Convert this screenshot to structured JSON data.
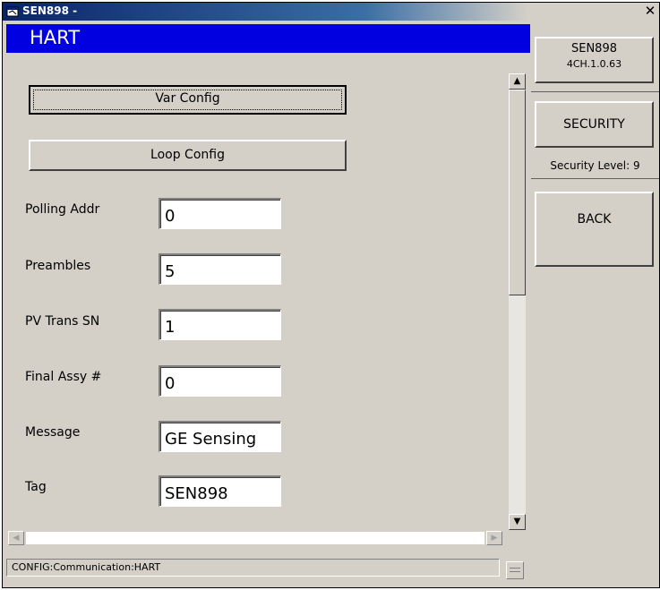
{
  "window": {
    "title": "SEN898 -",
    "close_glyph": "✕"
  },
  "header": {
    "title": "HART"
  },
  "buttons": {
    "var_config": "Var Config",
    "loop_config": "Loop Config"
  },
  "fields": [
    {
      "label": "Polling Addr",
      "value": "0"
    },
    {
      "label": "Preambles",
      "value": "5"
    },
    {
      "label": "PV Trans SN",
      "value": "1"
    },
    {
      "label": "Final Assy #",
      "value": "0"
    },
    {
      "label": "Message",
      "value": "GE Sensing"
    },
    {
      "label": "Tag",
      "value": "SEN898"
    }
  ],
  "sidebar": {
    "device_name": "SEN898",
    "version": "4CH.1.0.63",
    "security_button": "SECURITY",
    "security_level": "Security Level: 9",
    "back_button": "BACK"
  },
  "status": {
    "path": "CONFIG:Communication:HART"
  },
  "colors": {
    "header_blue": "#0000e0",
    "window_gray": "#d4d0c8",
    "title_blue": "#0a246a"
  },
  "icons": {
    "app_icon": "app-window-icon",
    "scroll_up": "scroll-up-arrow-icon",
    "scroll_down": "scroll-down-arrow-icon",
    "scroll_left": "scroll-left-arrow-icon",
    "scroll_right": "scroll-right-arrow-icon"
  }
}
